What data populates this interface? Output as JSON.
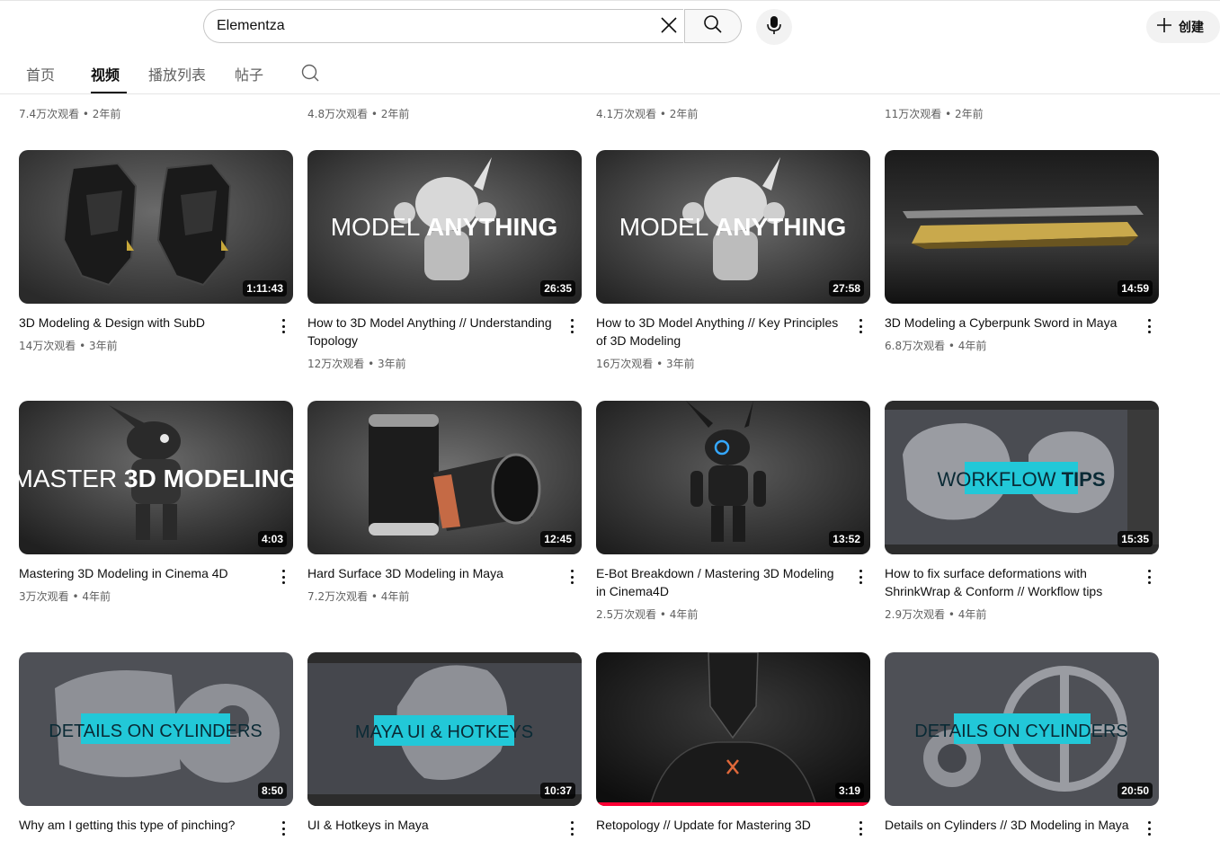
{
  "search": {
    "value": "Elementza",
    "clear_icon": "close-icon",
    "search_icon": "search-icon",
    "mic_icon": "mic-icon"
  },
  "header": {
    "create_label": "创建",
    "create_icon": "plus-icon"
  },
  "tabs": [
    {
      "label": "首页",
      "active": false
    },
    {
      "label": "视频",
      "active": true
    },
    {
      "label": "播放列表",
      "active": false
    },
    {
      "label": "帖子",
      "active": false
    }
  ],
  "top_row_meta": [
    "7.4万次观看 • 2年前",
    "4.8万次观看 • 2年前",
    "4.1万次观看 • 2年前",
    "11万次观看 • 2年前"
  ],
  "videos": [
    {
      "title": "3D Modeling & Design with SubD",
      "meta": "14万次观看 • 3年前",
      "duration": "1:11:43",
      "overlay": ""
    },
    {
      "title": "How to 3D Model Anything // Understanding Topology",
      "meta": "12万次观看 • 3年前",
      "duration": "26:35",
      "overlay_a": "MODEL",
      "overlay_b": "ANYTHING"
    },
    {
      "title": "How to 3D Model Anything // Key Principles of 3D Modeling",
      "meta": "16万次观看 • 3年前",
      "duration": "27:58",
      "overlay_a": "MODEL",
      "overlay_b": "ANYTHING"
    },
    {
      "title": "3D Modeling a Cyberpunk Sword in Maya",
      "meta": "6.8万次观看 • 4年前",
      "duration": "14:59",
      "overlay": ""
    },
    {
      "title": "Mastering 3D Modeling in Cinema 4D",
      "meta": "3万次观看 • 4年前",
      "duration": "4:03",
      "overlay_a": "MASTER",
      "overlay_b": "3D MODELING"
    },
    {
      "title": "Hard Surface 3D Modeling in Maya",
      "meta": "7.2万次观看 • 4年前",
      "duration": "12:45",
      "overlay": ""
    },
    {
      "title": "E-Bot Breakdown / Mastering 3D Modeling in Cinema4D",
      "meta": "2.5万次观看 • 4年前",
      "duration": "13:52",
      "overlay": ""
    },
    {
      "title": "How to fix surface deformations with ShrinkWrap & Conform // Workflow tips",
      "meta": "2.9万次观看 • 4年前",
      "duration": "15:35",
      "overlay_a": "WORKFLOW",
      "overlay_b": "TIPS"
    },
    {
      "title": "Why am I getting this type of pinching?",
      "meta": "",
      "duration": "8:50",
      "overlay_a": "DETAILS ON",
      "overlay_b": "CYLINDERS"
    },
    {
      "title": "UI & Hotkeys in Maya",
      "meta": "",
      "duration": "10:37",
      "overlay_a": "MAYA UI",
      "overlay_b": "& HOTKEYS"
    },
    {
      "title": "Retopology // Update for Mastering 3D",
      "meta": "",
      "duration": "3:19",
      "overlay": "",
      "watched_fraction": 1.0
    },
    {
      "title": "Details on Cylinders // 3D Modeling in Maya",
      "meta": "",
      "duration": "20:50",
      "overlay_a": "DETAILS ON",
      "overlay_b": "CYLINDERS"
    }
  ]
}
